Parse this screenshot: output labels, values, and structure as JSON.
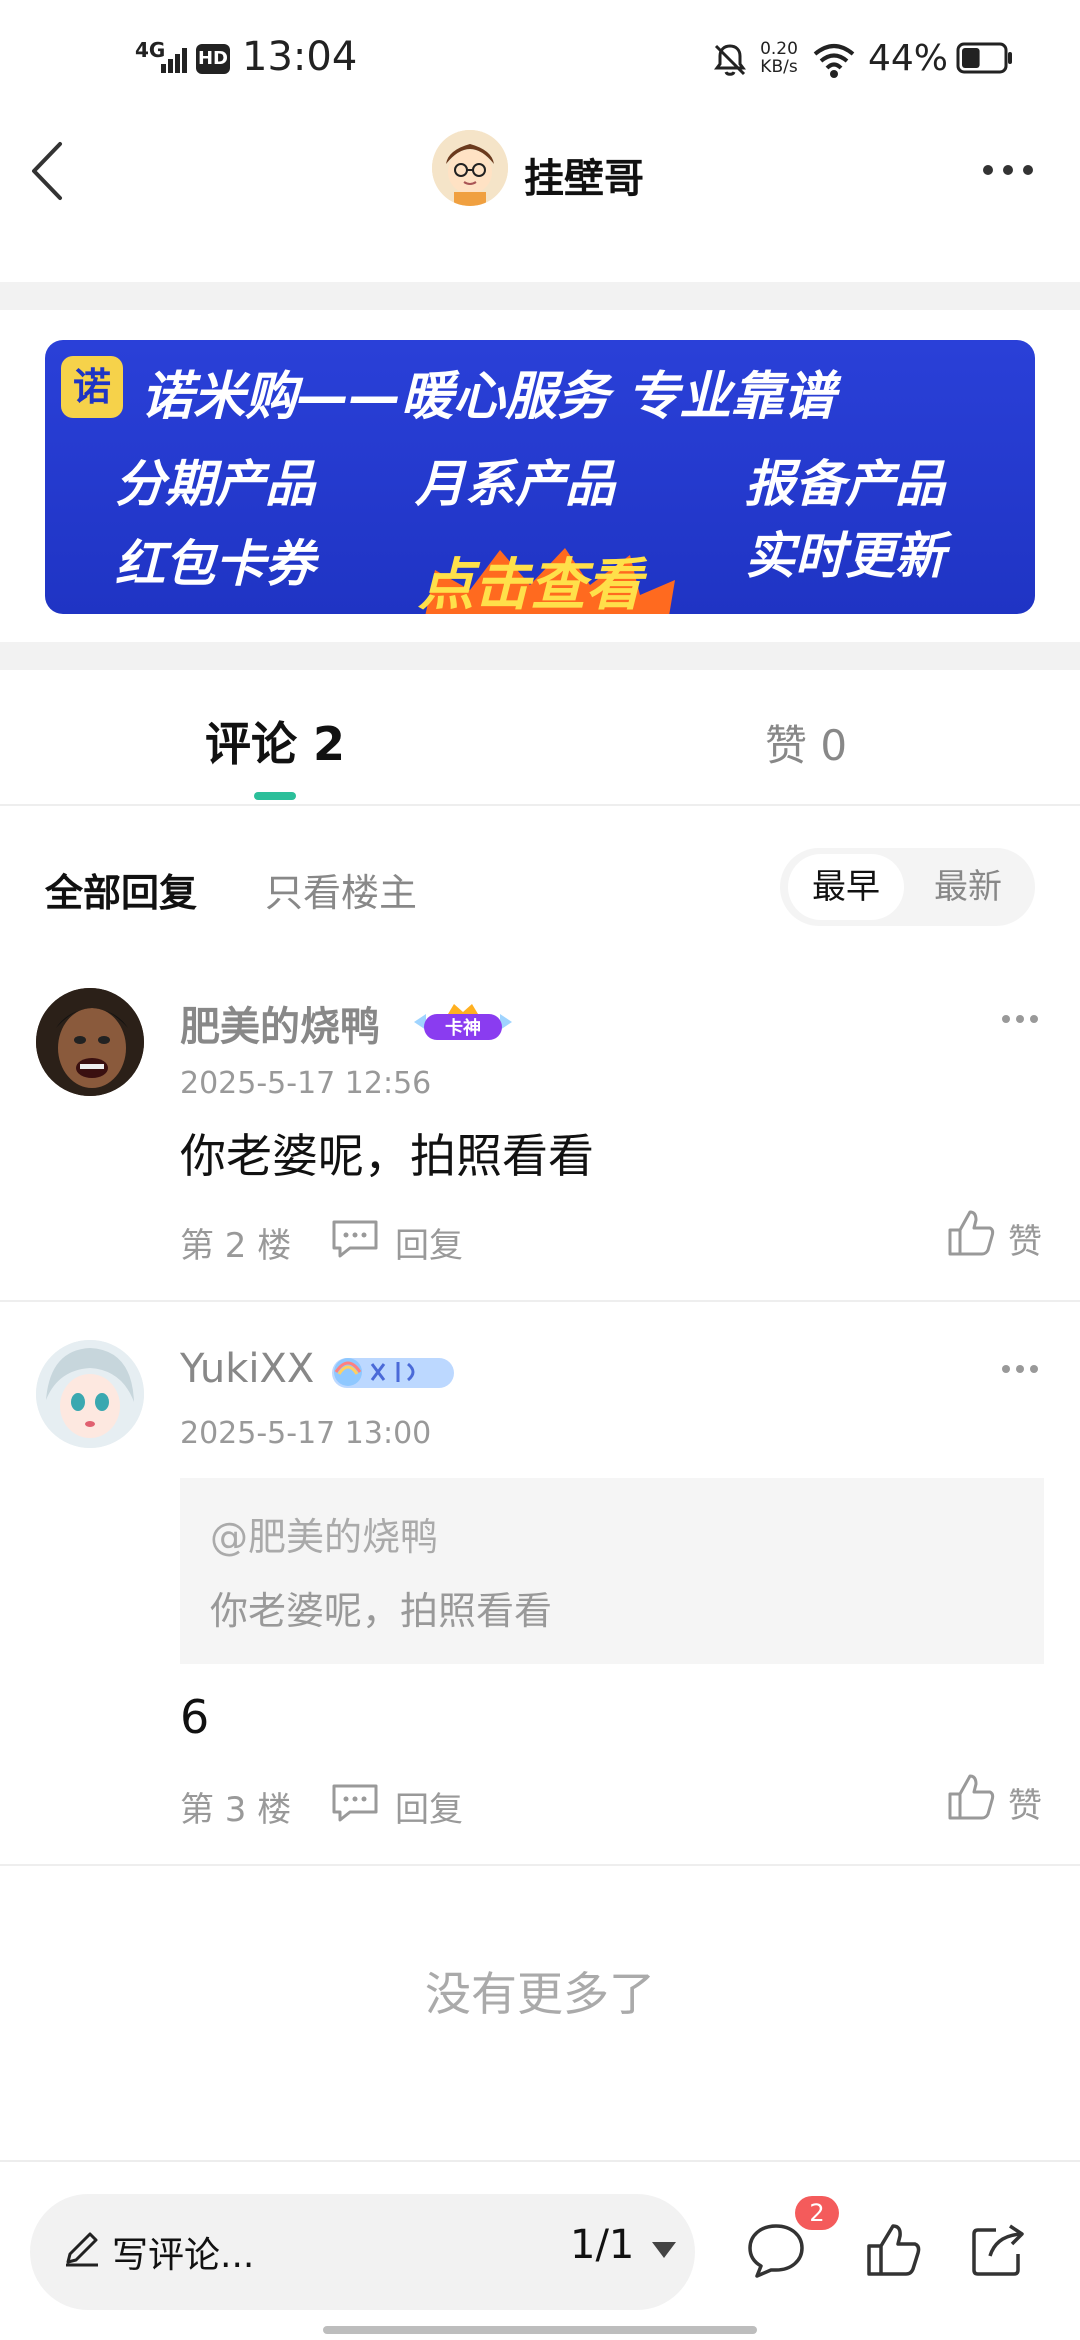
{
  "status_bar": {
    "network": "4G",
    "hd": "HD",
    "time": "13:04",
    "speed_value": "0.20",
    "speed_unit": "KB/s",
    "battery_pct": "44%",
    "battery_level": 0.44
  },
  "header": {
    "title": "挂壁哥"
  },
  "banner": {
    "logo_char": "诺",
    "title": "诺米购——暖心服务 专业靠谱",
    "items": [
      "分期产品",
      "月系产品",
      "报备产品",
      "红包卡券",
      "实时更新"
    ],
    "cta": "点击查看"
  },
  "tabs": {
    "comments": "评论 2",
    "likes": "赞 0"
  },
  "filters": {
    "all": "全部回复",
    "op_only": "只看楼主",
    "sort_earliest": "最早",
    "sort_latest": "最新"
  },
  "comments": [
    {
      "user": "肥美的烧鸭",
      "badge": "卡神",
      "time": "2025-5-17 12:56",
      "text": "你老婆呢，拍照看看",
      "floor": "第 2 楼",
      "reply": "回复",
      "like": "赞"
    },
    {
      "user": "YukiXX",
      "time": "2025-5-17 13:00",
      "quote_user": "@肥美的烧鸭",
      "quote_text": "你老婆呢，拍照看看",
      "text": "6",
      "floor": "第 3 楼",
      "reply": "回复",
      "like": "赞"
    }
  ],
  "end_text": "没有更多了",
  "bottom_bar": {
    "write_placeholder": "写评论...",
    "page": "1/1",
    "comment_count": "2"
  },
  "colors": {
    "accent": "#2bbf9a",
    "banner_blue": "#2a40d8",
    "badge_red": "#f45b5b"
  }
}
